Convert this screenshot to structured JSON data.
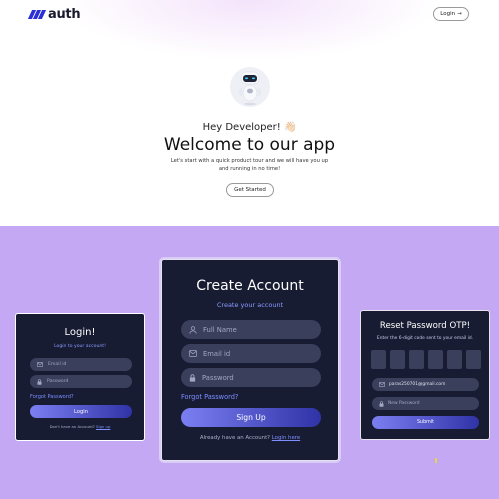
{
  "header": {
    "logo_text": "auth",
    "login_label": "Login",
    "login_arrow": "→"
  },
  "hero": {
    "greeting": "Hey Developer! 👋🏻",
    "title": "Welcome to our app",
    "description": "Let's start with a quick product tour and we will have you up and running in no time!",
    "cta": "Get Started"
  },
  "login_card": {
    "title": "Login!",
    "subtitle": "Login to your account!",
    "email_placeholder": "Email id",
    "password_placeholder": "Password",
    "forgot": "Forgot Password?",
    "submit": "Login",
    "footer_text": "Don't have an Account?",
    "footer_link": "Sign up"
  },
  "signup_card": {
    "title": "Create Account",
    "subtitle": "Create your account",
    "name_placeholder": "Full Name",
    "email_placeholder": "Email id",
    "password_placeholder": "Password",
    "forgot": "Forgot Password?",
    "submit": "Sign Up",
    "footer_text": "Already have an Account?",
    "footer_link": "Login here"
  },
  "reset_card": {
    "title": "Reset Password OTP!",
    "subtitle": "Enter the 6-digit code sent to your email id.",
    "otp_boxes": [
      "",
      "",
      "",
      "",
      "",
      ""
    ],
    "email_value": "paras250701@gmail.com",
    "password_placeholder": "New Password",
    "submit": "Submit"
  },
  "colors": {
    "brand": "#2b2fd6",
    "section_bg": "#c4a8f4",
    "card_bg": "#171c33",
    "accent": "#7e8eff"
  }
}
